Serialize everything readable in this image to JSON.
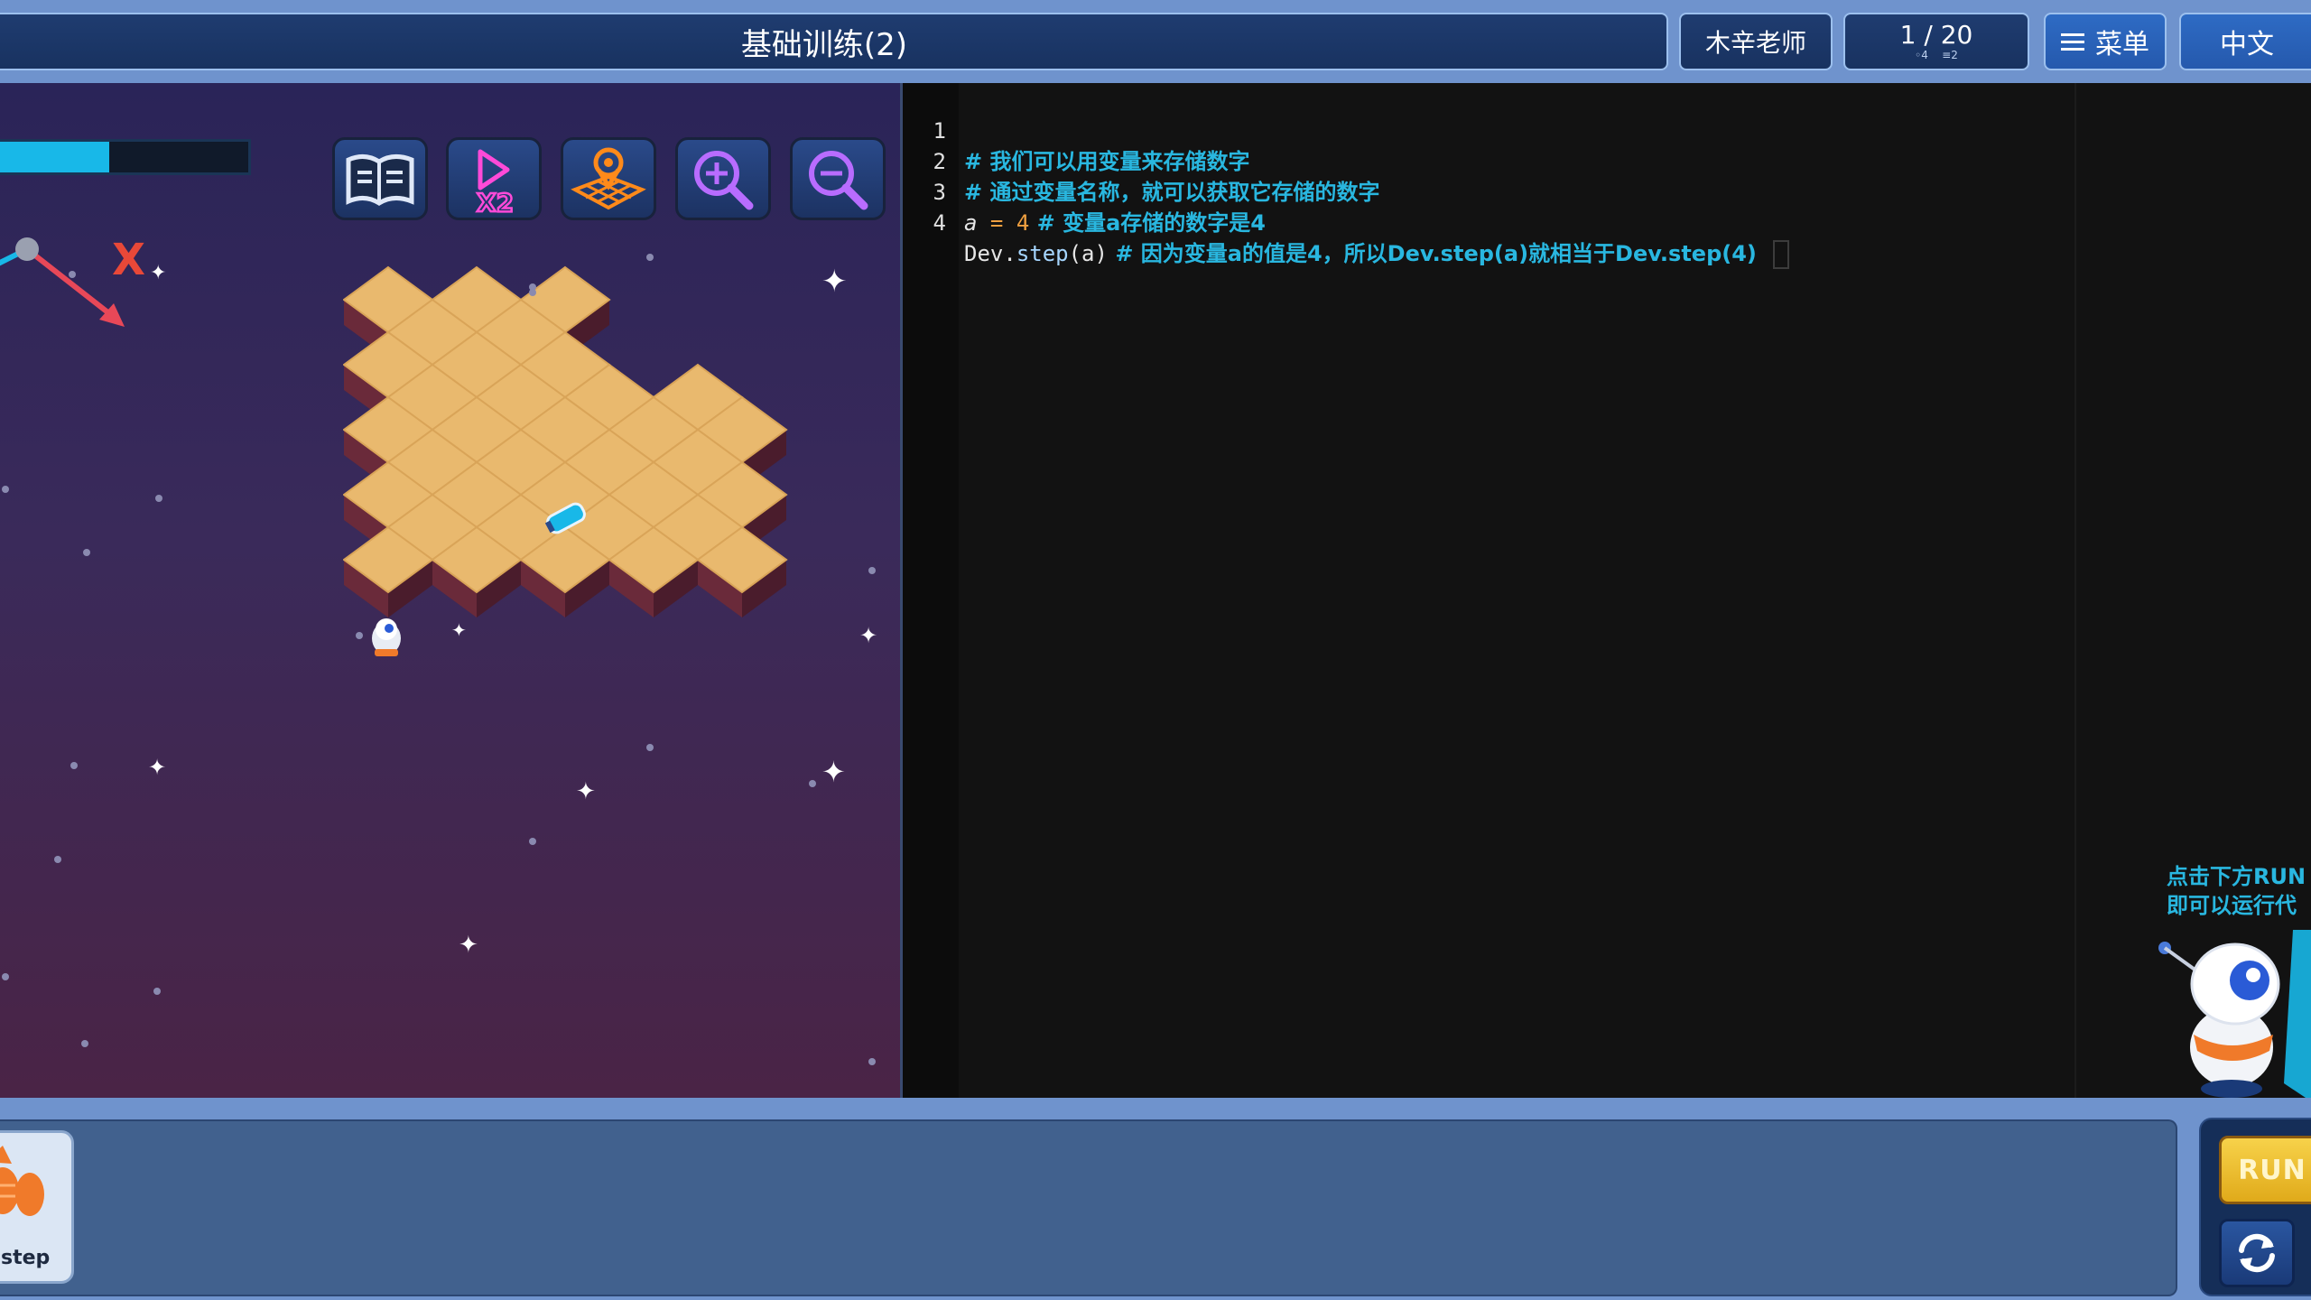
{
  "header": {
    "title": "基础训练(2)",
    "teacher": "木辛老师",
    "progress": "1 / 20",
    "progress_sub_a": "4",
    "progress_sub_b": "2",
    "menu_label": "菜单",
    "language_label": "中文"
  },
  "game": {
    "health_fill_fraction": 0.44,
    "direction_marker": "X",
    "tools": [
      {
        "name": "manual-book-icon"
      },
      {
        "name": "speed-x2-icon",
        "label": "X2"
      },
      {
        "name": "map-location-icon"
      },
      {
        "name": "zoom-in-icon"
      },
      {
        "name": "zoom-out-icon"
      }
    ]
  },
  "editor": {
    "lines": [
      {
        "num": "1",
        "comment": "# 我们可以用变量来存储数字"
      },
      {
        "num": "2",
        "comment": "# 通过变量名称，就可以获取它存储的数字"
      },
      {
        "num": "3",
        "var": "a",
        "op": " = ",
        "value": "4",
        "comment": " # 变量a存储的数字是4"
      },
      {
        "num": "4",
        "obj": "Dev",
        "dot": ".",
        "fn": "step",
        "args": "(a)",
        "comment": " # 因为变量a的值是4，所以Dev.step(a)就相当于Dev.step(4)"
      }
    ]
  },
  "assistant": {
    "hint_line1": "点击下方RUN",
    "hint_line2": "即可以运行代"
  },
  "palette": {
    "step_label": "step"
  },
  "controls": {
    "run_label": "RUN"
  },
  "colors": {
    "accent": "#29b7e0",
    "run": "#f0c030",
    "frame": "#6f93cd"
  }
}
